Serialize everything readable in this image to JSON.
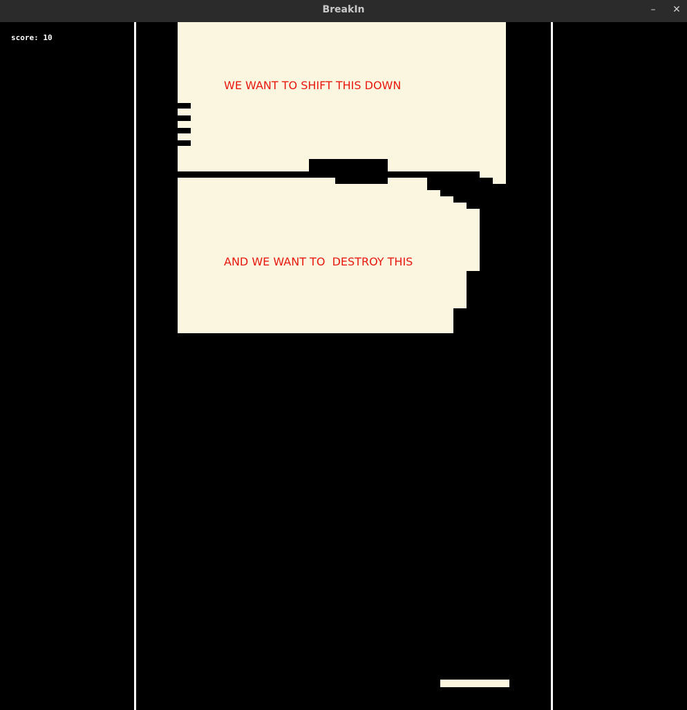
{
  "window": {
    "title": "BreakIn",
    "minimize_glyph": "–",
    "close_glyph": "✕"
  },
  "hud": {
    "score_text": "score: 10"
  },
  "bricks": {
    "top_label": "WE WANT TO SHIFT THIS DOWN",
    "bottom_label": "AND WE WANT TO  DESTROY THIS"
  },
  "colors": {
    "background": "#000000",
    "brick": "#faf6e0",
    "label_text": "#e8180e",
    "wall": "#ffffff"
  }
}
